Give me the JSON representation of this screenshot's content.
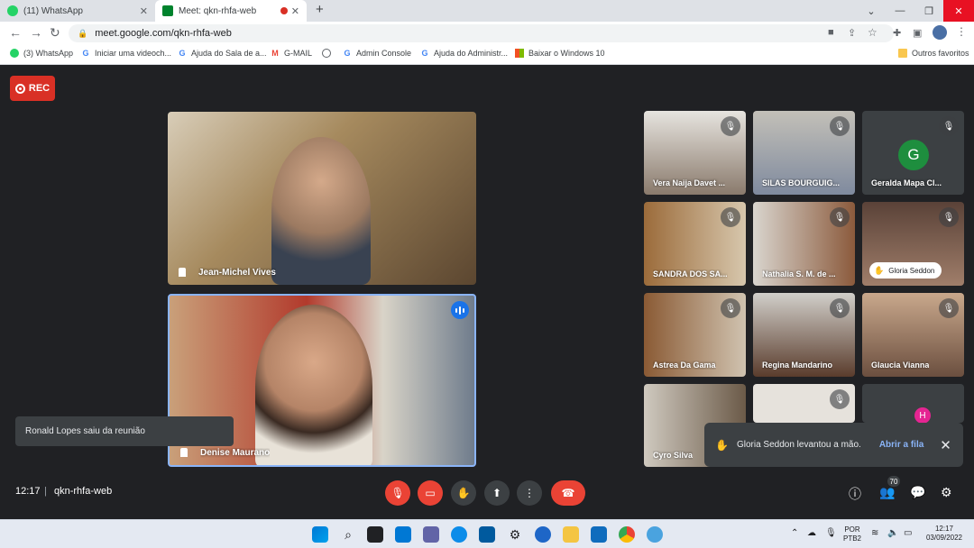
{
  "browser": {
    "tabs": [
      {
        "label": "(11) WhatsApp"
      },
      {
        "label": "Meet: qkn-rhfa-web"
      }
    ],
    "new_tab": "+",
    "address": "meet.google.com/qkn-rhfa-web",
    "bookmarks": [
      {
        "label": "(3) WhatsApp",
        "icon": "whatsapp-icon"
      },
      {
        "label": "Iniciar uma videoch...",
        "icon": "google-icon"
      },
      {
        "label": "Ajuda do Sala de a...",
        "icon": "google-icon"
      },
      {
        "label": "G-MAIL",
        "icon": "gmail-icon"
      },
      {
        "label": "Admin Console",
        "icon": "google-icon"
      },
      {
        "label": "Ajuda do Administr...",
        "icon": "google-icon"
      },
      {
        "label": "Baixar o Windows 10",
        "icon": "windows-icon"
      },
      {
        "label": "Outros favoritos",
        "icon": "folder-icon"
      }
    ]
  },
  "meet": {
    "rec_label": "REC",
    "main_tiles": [
      {
        "name": "Jean-Michel Vives"
      },
      {
        "name": "Denise Maurano"
      }
    ],
    "grid_tiles": [
      {
        "name": "Vera Naija Davet ..."
      },
      {
        "name": "SILAS BOURGUIG..."
      },
      {
        "name": "Geralda Mapa Cl...",
        "avatar_letter": "G"
      },
      {
        "name": "SANDRA DOS SA..."
      },
      {
        "name": "Nathalia S. M. de ..."
      },
      {
        "name": "Gloria Seddon"
      },
      {
        "name": "Astrea Da Gama"
      },
      {
        "name": "Regina Mandarino"
      },
      {
        "name": "Glaucia Vianna"
      },
      {
        "name": "Cyro Silva"
      },
      {
        "name": ""
      },
      {
        "name": "",
        "avatar_letter": "H"
      }
    ],
    "toast_left": "Ronald Lopes saiu da reunião",
    "toast_right": {
      "message": "Gloria Seddon levantou a mão.",
      "action": "Abrir a fila"
    },
    "time": "12:17",
    "separator": "|",
    "meeting_code": "qkn-rhfa-web",
    "participant_count": "70"
  },
  "taskbar": {
    "lang_top": "POR",
    "lang_bottom": "PTB2",
    "clock_time": "12:17",
    "clock_date": "03/09/2022"
  },
  "colors": {
    "meet_bg": "#202124",
    "end_red": "#ea4335",
    "accent_blue": "#8ab4f8",
    "rec_red": "#d93025"
  }
}
